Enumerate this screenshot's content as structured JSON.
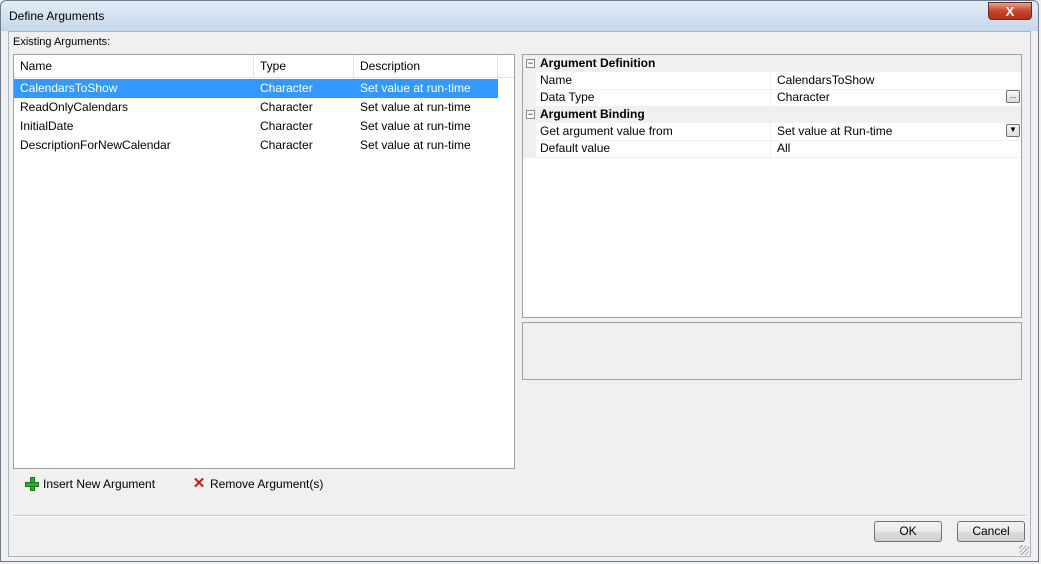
{
  "window": {
    "title": "Define Arguments",
    "close_glyph": "X"
  },
  "existing": {
    "label": "Existing Arguments:"
  },
  "columns": [
    "Name",
    "Type",
    "Description"
  ],
  "rows": [
    {
      "name": "CalendarsToShow",
      "type": "Character",
      "description": "Set value at run-time",
      "selected": true
    },
    {
      "name": "ReadOnlyCalendars",
      "type": "Character",
      "description": "Set value at run-time",
      "selected": false
    },
    {
      "name": "InitialDate",
      "type": "Character",
      "description": "Set value at run-time",
      "selected": false
    },
    {
      "name": "DescriptionForNewCalendar",
      "type": "Character",
      "description": "Set value at run-time",
      "selected": false
    }
  ],
  "actions": {
    "insert_label": "Insert New Argument",
    "remove_label": "Remove Argument(s)"
  },
  "propgrid": {
    "cat1": "Argument Definition",
    "cat2": "Argument Binding",
    "name_label": "Name",
    "name_value": "CalendarsToShow",
    "datatype_label": "Data Type",
    "datatype_value": "Character",
    "getfrom_label": "Get argument value from",
    "getfrom_value": "Set value at Run-time",
    "default_label": "Default value",
    "default_value": "All",
    "ellipsis": "...",
    "collapse": "−",
    "dropdown_glyph": "▼"
  },
  "buttons": {
    "ok": "OK",
    "cancel": "Cancel"
  },
  "colors": {
    "selection": "#3399ff"
  }
}
